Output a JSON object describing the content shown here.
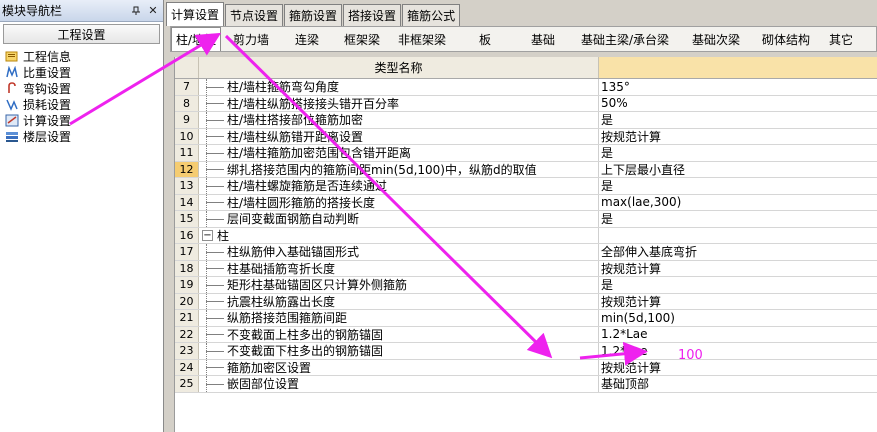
{
  "nav": {
    "title": "模块导航栏",
    "pin_glyph": "ᵖ",
    "close_glyph": "✕",
    "section": "工程设置",
    "items": [
      {
        "label": "工程信息",
        "icon": "info-icon"
      },
      {
        "label": "比重设置",
        "icon": "weight-icon"
      },
      {
        "label": "弯钩设置",
        "icon": "hook-icon"
      },
      {
        "label": "损耗设置",
        "icon": "loss-icon"
      },
      {
        "label": "计算设置",
        "icon": "calc-icon"
      },
      {
        "label": "楼层设置",
        "icon": "floor-icon"
      }
    ]
  },
  "tabs": [
    "计算设置",
    "节点设置",
    "箍筋设置",
    "搭接设置",
    "箍筋公式"
  ],
  "active_tab": 0,
  "subtabs": [
    "柱/墙柱",
    "剪力墙",
    "连梁",
    "框架梁",
    "非框架梁",
    "板",
    "基础",
    "基础主梁/承台梁",
    "基础次梁",
    "砌体结构",
    "其它"
  ],
  "active_subtab": 0,
  "grid": {
    "header": "类型名称",
    "selected_row": "12",
    "rows": [
      {
        "num": "7",
        "name": "柱/墙柱箍筋弯勾角度",
        "value": "135°"
      },
      {
        "num": "8",
        "name": "柱/墙柱纵筋搭接接头错开百分率",
        "value": "50%"
      },
      {
        "num": "9",
        "name": "柱/墙柱搭接部位箍筋加密",
        "value": "是"
      },
      {
        "num": "10",
        "name": "柱/墙柱纵筋错开距离设置",
        "value": "按规范计算"
      },
      {
        "num": "11",
        "name": "柱/墙柱箍筋加密范围包含错开距离",
        "value": "是"
      },
      {
        "num": "12",
        "name": "绑扎搭接范围内的箍筋间距min(5d,100)中，纵筋d的取值",
        "value": "上下层最小直径"
      },
      {
        "num": "13",
        "name": "柱/墙柱螺旋箍筋是否连续通过",
        "value": "是"
      },
      {
        "num": "14",
        "name": "柱/墙柱圆形箍筋的搭接长度",
        "value": "max(lae,300)"
      },
      {
        "num": "15",
        "name": "层间变截面钢筋自动判断",
        "value": "是"
      },
      {
        "num": "16",
        "name": "柱",
        "value": "",
        "group": true
      },
      {
        "num": "17",
        "name": "柱纵筋伸入基础锚固形式",
        "value": "全部伸入基底弯折"
      },
      {
        "num": "18",
        "name": "柱基础插筋弯折长度",
        "value": "按规范计算"
      },
      {
        "num": "19",
        "name": "矩形柱基础锚固区只计算外侧箍筋",
        "value": "是"
      },
      {
        "num": "20",
        "name": "抗震柱纵筋露出长度",
        "value": "按规范计算"
      },
      {
        "num": "21",
        "name": "纵筋搭接范围箍筋间距",
        "value": "min(5d,100)"
      },
      {
        "num": "22",
        "name": "不变截面上柱多出的钢筋锚固",
        "value": "1.2*Lae"
      },
      {
        "num": "23",
        "name": "不变截面下柱多出的钢筋锚固",
        "value": "1.2*Lae"
      },
      {
        "num": "24",
        "name": "箍筋加密区设置",
        "value": "按规范计算"
      },
      {
        "num": "25",
        "name": "嵌固部位设置",
        "value": "基础顶部"
      }
    ]
  },
  "annotation": {
    "label": "100",
    "color": "#ee22ee"
  }
}
